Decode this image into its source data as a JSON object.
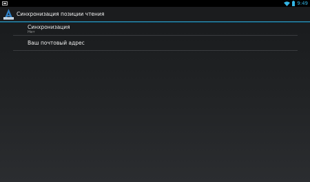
{
  "status_bar": {
    "time": "9:49"
  },
  "action_bar": {
    "title": "Синхронизация позиции чтения"
  },
  "preferences": [
    {
      "title": "Синхронизация",
      "summary": "Нет"
    },
    {
      "title": "Ваш почтовый адрес"
    }
  ],
  "colors": {
    "accent": "#33b5e5",
    "divider": "#3a3c3f"
  },
  "icons": {
    "status_left": "screenshot-icon",
    "wifi": "wifi-icon",
    "battery": "battery-icon",
    "app": "book-app-icon"
  }
}
